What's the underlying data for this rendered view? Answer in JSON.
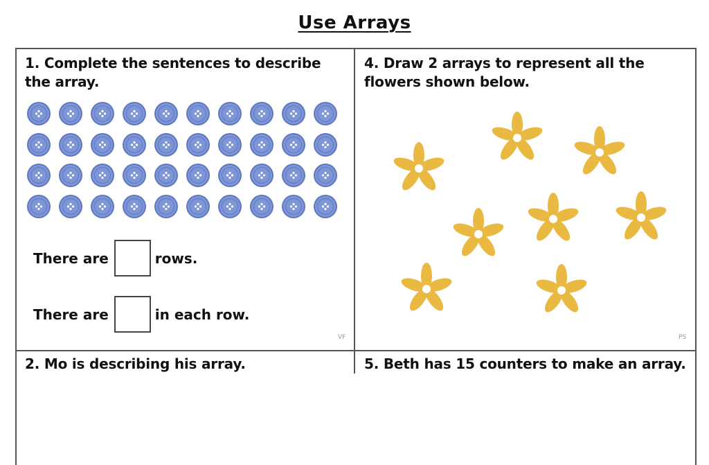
{
  "title": "Use Arrays",
  "colors": {
    "button_fill": "#7f96d6",
    "button_rim": "#5e77c0",
    "flower": "#e9b941",
    "border": "#555555"
  },
  "questions": {
    "q1": {
      "text": "1. Complete the sentences to describe the array.",
      "array": {
        "rows": 4,
        "columns": 10,
        "item_icon": "blue-button-icon"
      },
      "sentences": [
        {
          "before": "There are",
          "after": "rows.",
          "answer": ""
        },
        {
          "before": "There are",
          "after": "in each row.",
          "answer": ""
        }
      ],
      "code": "VF"
    },
    "q4": {
      "text": "4. Draw 2 arrays to represent  all the flowers shown below.",
      "flower_count": 8,
      "item_icon": "yellow-flower-icon",
      "code": "PS"
    },
    "q2": {
      "text": "2. Mo is describing his array."
    },
    "q5": {
      "text": "5. Beth has 15 counters to make an array."
    }
  }
}
